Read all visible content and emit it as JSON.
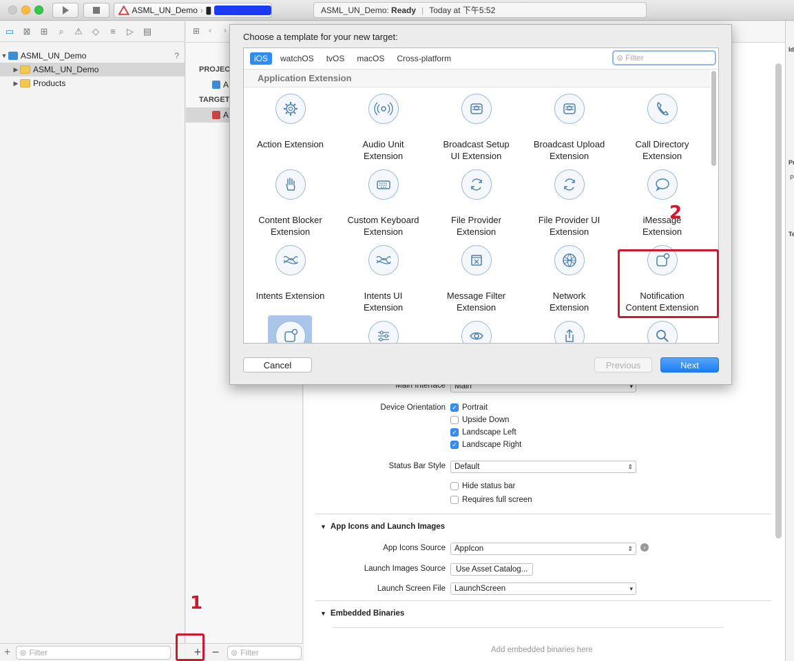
{
  "toolbar": {
    "scheme_name": "ASML_UN_Demo",
    "activity_project": "ASML_UN_Demo:",
    "activity_status": "Ready",
    "activity_time": "Today at 下午5:52"
  },
  "navigator": {
    "project": "ASML_UN_Demo",
    "help": "?",
    "items": [
      "ASML_UN_Demo",
      "Products"
    ],
    "filter_placeholder": "Filter"
  },
  "targets_pane": {
    "project_header": "PROJECT",
    "project_item": "A",
    "targets_header": "TARGETS",
    "target_item": "A",
    "filter_placeholder": "Filter"
  },
  "inspector": {
    "labels": [
      "Id",
      "Pr",
      "P",
      "Te"
    ]
  },
  "settings": {
    "main_interface_label": "Main Interface",
    "main_interface_value": "Main",
    "device_orientation_label": "Device Orientation",
    "orientations": [
      {
        "label": "Portrait",
        "checked": true
      },
      {
        "label": "Upside Down",
        "checked": false
      },
      {
        "label": "Landscape Left",
        "checked": true
      },
      {
        "label": "Landscape Right",
        "checked": true
      }
    ],
    "status_bar_style_label": "Status Bar Style",
    "status_bar_style_value": "Default",
    "hide_status_bar": "Hide status bar",
    "requires_full_screen": "Requires full screen",
    "app_icons_section": "App Icons and Launch Images",
    "app_icons_source_label": "App Icons Source",
    "app_icons_source_value": "AppIcon",
    "launch_images_source_label": "Launch Images Source",
    "launch_images_source_button": "Use Asset Catalog...",
    "launch_screen_file_label": "Launch Screen File",
    "launch_screen_file_value": "LaunchScreen",
    "embedded_binaries_section": "Embedded Binaries",
    "embedded_binaries_placeholder": "Add embedded binaries here"
  },
  "sheet": {
    "title": "Choose a template for your new target:",
    "tabs": [
      "iOS",
      "watchOS",
      "tvOS",
      "macOS",
      "Cross-platform"
    ],
    "active_tab": "iOS",
    "filter_placeholder": "Filter",
    "category": "Application Extension",
    "templates": [
      {
        "line1": "Action Extension",
        "line2": "",
        "icon": "gear-icon"
      },
      {
        "line1": "Audio Unit",
        "line2": "Extension",
        "icon": "audio-wave-icon"
      },
      {
        "line1": "Broadcast Setup",
        "line2": "UI Extension",
        "icon": "broadcast-stack-icon"
      },
      {
        "line1": "Broadcast Upload",
        "line2": "Extension",
        "icon": "broadcast-stack-icon"
      },
      {
        "line1": "Call Directory",
        "line2": "Extension",
        "icon": "phone-icon"
      },
      {
        "line1": "Content Blocker",
        "line2": "Extension",
        "icon": "hand-icon"
      },
      {
        "line1": "Custom Keyboard",
        "line2": "Extension",
        "icon": "keyboard-icon"
      },
      {
        "line1": "File Provider",
        "line2": "Extension",
        "icon": "sync-icon"
      },
      {
        "line1": "File Provider UI",
        "line2": "Extension",
        "icon": "sync-icon"
      },
      {
        "line1": "iMessage",
        "line2": "Extension",
        "icon": "speech-bubble-icon"
      },
      {
        "line1": "Intents Extension",
        "line2": "",
        "icon": "waves-icon"
      },
      {
        "line1": "Intents UI",
        "line2": "Extension",
        "icon": "waves-icon"
      },
      {
        "line1": "Message Filter",
        "line2": "Extension",
        "icon": "filter-box-icon"
      },
      {
        "line1": "Network",
        "line2": "Extension",
        "icon": "globe-icon"
      },
      {
        "line1": "Notification",
        "line2": "Content Extension",
        "icon": "notification-icon"
      },
      {
        "line1": "",
        "line2": "",
        "icon": "notification-icon"
      },
      {
        "line1": "",
        "line2": "",
        "icon": "sliders-icon"
      },
      {
        "line1": "",
        "line2": "",
        "icon": "eye-icon"
      },
      {
        "line1": "",
        "line2": "",
        "icon": "share-icon"
      },
      {
        "line1": "",
        "line2": "",
        "icon": "search-icon"
      }
    ],
    "cancel": "Cancel",
    "previous": "Previous",
    "next": "Next"
  },
  "annotations": {
    "step1": "1",
    "step2": "2",
    "color": "#d2162c"
  }
}
